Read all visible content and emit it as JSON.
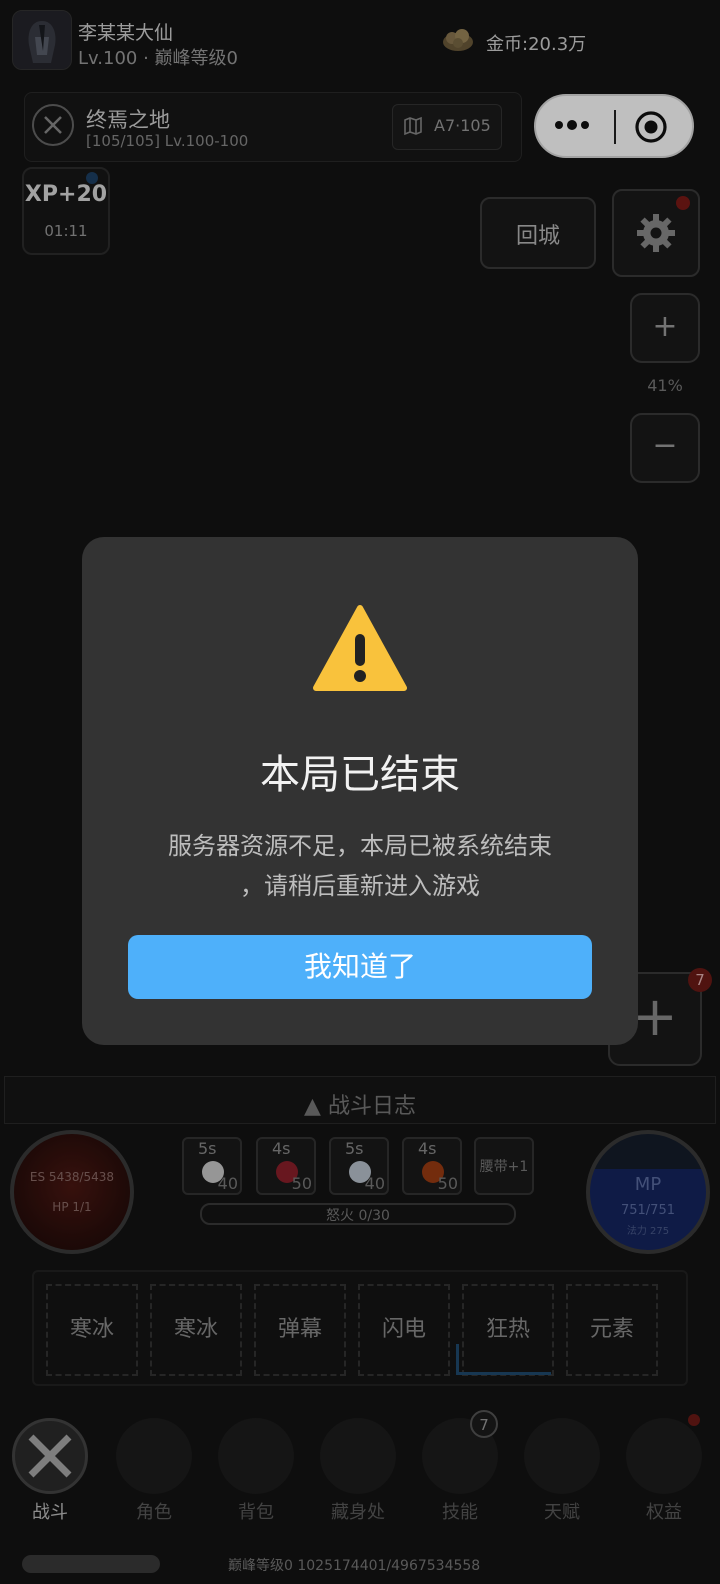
{
  "player": {
    "name": "李某某大仙",
    "level_text": "Lv.100 · 巅峰等级0"
  },
  "currency": {
    "gold_text": "金币:20.3万"
  },
  "zone": {
    "name": "终焉之地",
    "progress_text": "[105/105] Lv.100-100",
    "map_code": "A7·105"
  },
  "xp_boost": {
    "label": "XP+20",
    "timer": "01:11"
  },
  "controls": {
    "return_label": "回城",
    "zoom_in": "+",
    "zoom_level": "41%",
    "zoom_out": "−",
    "add_label": "+",
    "add_badge": "7"
  },
  "battle_log": {
    "label": "▲ 战斗日志"
  },
  "hp_orb": {
    "es_text": "ES 5438/5438",
    "hp_text": "HP 1/1"
  },
  "mp_orb": {
    "label": "MP",
    "value": "751/751",
    "sub": "法力 275"
  },
  "skills": [
    {
      "cooldown": "5s",
      "count": "40",
      "icon_color": "#c8c8c8"
    },
    {
      "cooldown": "4s",
      "count": "50",
      "icon_color": "#8b1f2a"
    },
    {
      "cooldown": "5s",
      "count": "40",
      "icon_color": "#b9c2cc"
    },
    {
      "cooldown": "4s",
      "count": "50",
      "icon_color": "#9a3b12"
    }
  ],
  "belt_label": "腰带+1",
  "rage_text": "怒火 0/30",
  "spell_slots": [
    "寒冰",
    "寒冰",
    "弹幕",
    "闪电",
    "狂热",
    "元素"
  ],
  "nav": [
    {
      "label": "战斗",
      "active": true
    },
    {
      "label": "角色"
    },
    {
      "label": "背包"
    },
    {
      "label": "藏身处"
    },
    {
      "label": "技能"
    },
    {
      "label": "天赋"
    },
    {
      "label": "权益"
    }
  ],
  "nav_skill_badge": "7",
  "exp_text": "巅峰等级0  1025174401/4967534558",
  "modal": {
    "title": "本局已结束",
    "line1": "服务器资源不足，本局已被系统结束",
    "line2": "，请稍后重新进入游戏",
    "button": "我知道了"
  },
  "colors": {
    "accent_button": "#4eb0fa",
    "warning": "#f9c23c",
    "modal_bg": "#333333"
  },
  "icons": [
    "avatar",
    "gold-icon",
    "crossed-swords-icon",
    "map-icon",
    "more-dots-icon",
    "target-icon",
    "gear-icon",
    "warning-icon"
  ]
}
